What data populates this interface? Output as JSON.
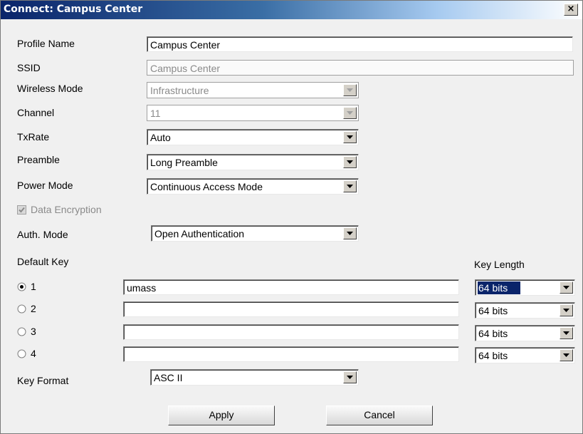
{
  "window": {
    "title": "Connect: Campus Center",
    "close_label": "×"
  },
  "form": {
    "profile_name": {
      "label": "Profile Name",
      "value": "Campus Center"
    },
    "ssid": {
      "label": "SSID",
      "value": "Campus Center"
    },
    "wireless_mode": {
      "label": "Wireless Mode",
      "value": "Infrastructure"
    },
    "channel": {
      "label": "Channel",
      "value": "11"
    },
    "txrate": {
      "label": "TxRate",
      "value": "Auto"
    },
    "preamble": {
      "label": "Preamble",
      "value": "Long Preamble"
    },
    "power_mode": {
      "label": "Power Mode",
      "value": "Continuous Access Mode"
    },
    "data_encryption": {
      "label": "Data Encryption",
      "checked": true
    },
    "auth_mode": {
      "label": "Auth. Mode",
      "value": "Open Authentication"
    },
    "default_key_label": "Default Key",
    "key_length_label": "Key Length",
    "keys": [
      {
        "index": "1",
        "value": "umass",
        "length": "64 bits",
        "selected": true
      },
      {
        "index": "2",
        "value": "",
        "length": "64 bits",
        "selected": false
      },
      {
        "index": "3",
        "value": "",
        "length": "64 bits",
        "selected": false
      },
      {
        "index": "4",
        "value": "",
        "length": "64 bits",
        "selected": false
      }
    ],
    "key_format": {
      "label": "Key Format",
      "value": "ASC II"
    }
  },
  "buttons": {
    "apply": "Apply",
    "cancel": "Cancel"
  },
  "icons": {
    "close": "close-icon",
    "dropdown": "chevron-down-icon",
    "check": "checkmark-icon",
    "radio": "radio-icon"
  }
}
